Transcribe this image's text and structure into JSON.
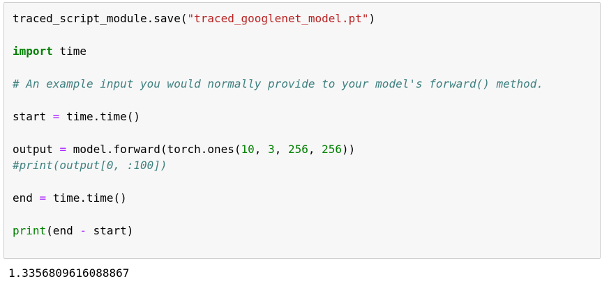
{
  "code_cell": {
    "line1": {
      "obj": "traced_script_module.save(",
      "str": "\"traced_googlenet_model.pt\"",
      "close": ")"
    },
    "line2": {
      "kw": "import",
      "rest": " time"
    },
    "line3": {
      "comment": "# An example input you would normally provide to your model's forward() method."
    },
    "line4": {
      "var": "start ",
      "op": "=",
      "rest": " time.time()"
    },
    "line5": {
      "var": "output ",
      "op": "=",
      "call": " model.forward(torch.ones(",
      "n1": "10",
      "sep1": ", ",
      "n2": "3",
      "sep2": ", ",
      "n3": "256",
      "sep3": ", ",
      "n4": "256",
      "close": "))"
    },
    "line6": {
      "comment": "#print(output[0, :100])"
    },
    "line7": {
      "var": "end ",
      "op": "=",
      "rest": " time.time()"
    },
    "line8": {
      "builtin": "print",
      "open": "(end ",
      "op": "-",
      "close": " start)"
    }
  },
  "output_cell": {
    "text": "1.3356809616088867"
  },
  "colors": {
    "keyword": "#008000",
    "string": "#ba2121",
    "number": "#008000",
    "operator": "#aa22ff",
    "comment": "#408080",
    "cell_background": "#f7f7f7",
    "cell_border": "#cfcfcf"
  }
}
